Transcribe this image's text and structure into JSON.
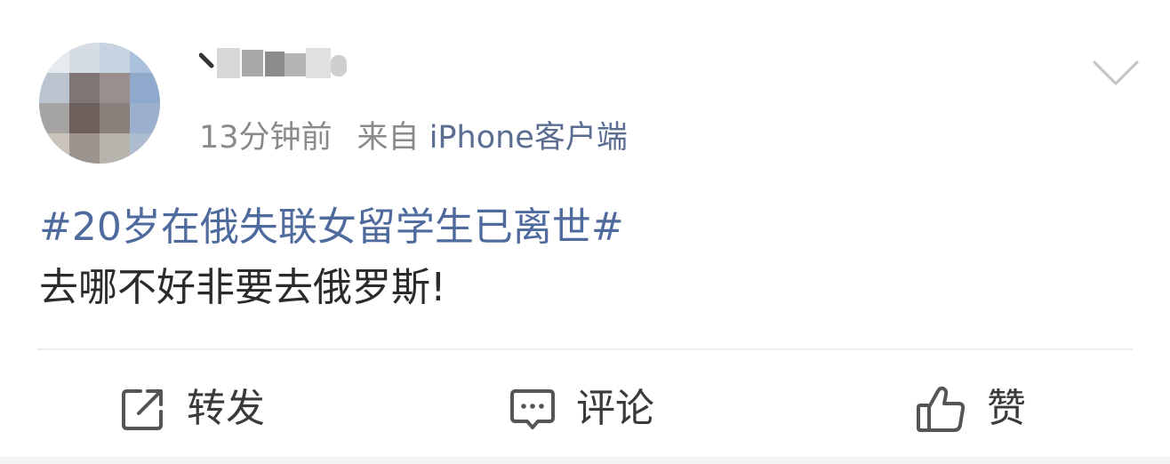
{
  "post": {
    "username": "\\ (pixelated)",
    "time": "13分钟前",
    "source_prefix": "来自",
    "source": "iPhone客户端",
    "topic": "#20岁在俄失联女留学生已离世#",
    "text": "去哪不好非要去俄罗斯!"
  },
  "actions": {
    "repost_label": "转发",
    "comment_label": "评论",
    "like_label": "赞"
  },
  "icons": {
    "more": "chevron-down-icon",
    "repost": "share-square-icon",
    "comment": "comment-bubble-icon",
    "like": "thumbs-up-icon"
  },
  "colors": {
    "topic": "#4f6a9d",
    "source": "#5b6e92",
    "meta": "#8a8a8a",
    "text": "#2b2b2b"
  }
}
